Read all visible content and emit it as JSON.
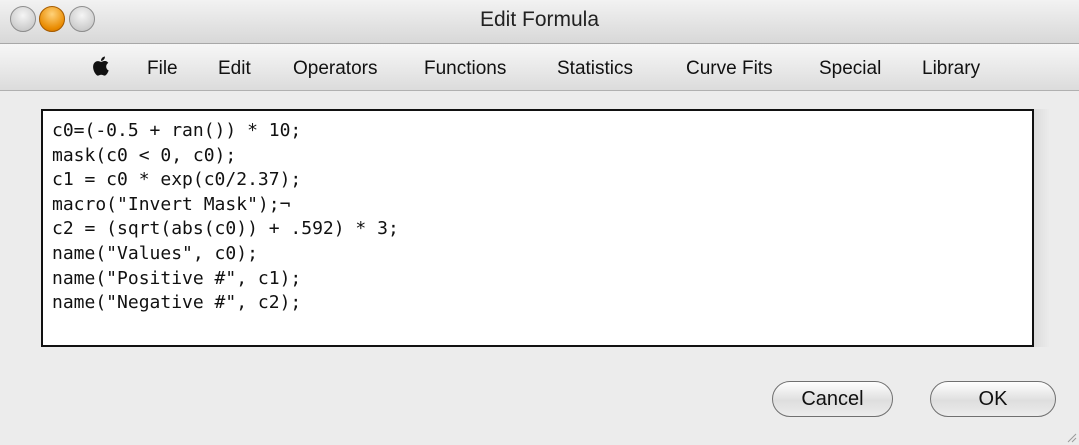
{
  "window": {
    "title": "Edit Formula"
  },
  "menubar": {
    "apple_icon": "apple-icon",
    "items": [
      "File",
      "Edit",
      "Operators",
      "Functions",
      "Statistics",
      "Curve Fits",
      "Special",
      "Library"
    ]
  },
  "editor": {
    "lines": [
      "c0=(-0.5 + ran()) * 10;",
      "mask(c0 < 0, c0);",
      "c1 = c0 * exp(c0/2.37);",
      "macro(\"Invert Mask\");¬",
      "c2 = (sqrt(abs(c0)) + .592) * 3;",
      "name(\"Values\", c0);",
      "name(\"Positive #\", c1);",
      "name(\"Negative #\", c2);"
    ]
  },
  "buttons": {
    "cancel": "Cancel",
    "ok": "OK"
  }
}
